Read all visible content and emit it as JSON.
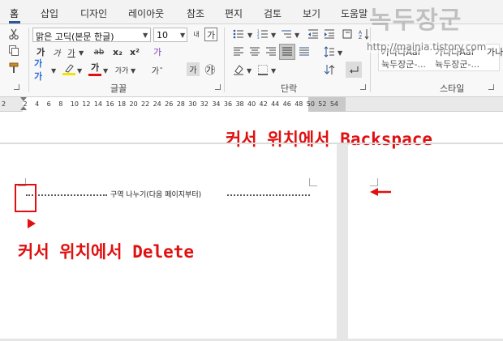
{
  "tabs": [
    {
      "label": "홈",
      "active": true
    },
    {
      "label": "삽입"
    },
    {
      "label": "디자인"
    },
    {
      "label": "레이아웃"
    },
    {
      "label": "참조"
    },
    {
      "label": "편지"
    },
    {
      "label": "검토"
    },
    {
      "label": "보기"
    },
    {
      "label": "도움말"
    }
  ],
  "ribbon": {
    "font_name": "맑은 고딕(본문 한글)",
    "font_size": "10",
    "size_grow_label": "내",
    "font_char_box": "가",
    "bold_label": "가",
    "italic_label": "가",
    "underline_label": "가",
    "strike_label": "ab",
    "subscript_label": "x₂",
    "superscript_label": "x²",
    "clear_format_label": "가",
    "case_label": "가가",
    "char_spacing_label": "가ˇ",
    "enclosed_label": "㉮",
    "highlight_label": "가",
    "font_color_label": "가",
    "groups": {
      "font": "글꼴",
      "paragraph": "단락",
      "styles": "스타일"
    },
    "styles": [
      {
        "preview": "가나다Aaf",
        "name": "뉵두장군-..."
      },
      {
        "preview": "가나다Aaf",
        "name": "뉵두장군-..."
      },
      {
        "preview": "가나"
      }
    ]
  },
  "watermark": {
    "title": "녹두장군",
    "url": "http://mainia.tistory.com"
  },
  "ruler": {
    "ticks": [
      "2",
      "2",
      "4",
      "6",
      "8",
      "10",
      "12",
      "14",
      "16",
      "18",
      "20",
      "22",
      "24",
      "26",
      "28",
      "30",
      "32",
      "34",
      "36",
      "38",
      "40",
      "42",
      "44",
      "46",
      "48",
      "50",
      "52",
      "54"
    ]
  },
  "document": {
    "note_backspace": "커서 위치에서 Backspace",
    "note_delete": "커서 위치에서 Delete",
    "section_break": "구역 나누기(다음 페이지부터)"
  },
  "colors": {
    "accent": "#2b579a",
    "annotation_red": "#e01010"
  }
}
